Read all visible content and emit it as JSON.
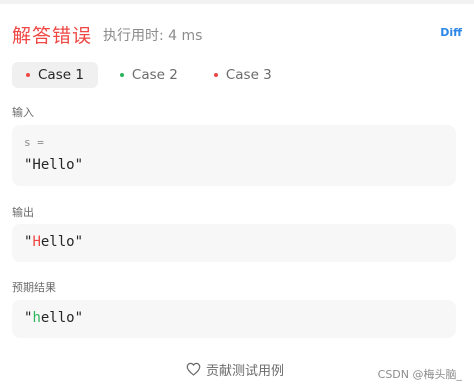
{
  "header": {
    "result": "解答错误",
    "runtime": "执行用时: 4 ms",
    "diff_label": "Diff"
  },
  "tabs": [
    {
      "label": "Case 1",
      "dot_color": "#ef4743",
      "active": true
    },
    {
      "label": "Case 2",
      "dot_color": "#2db55d",
      "active": false
    },
    {
      "label": "Case 3",
      "dot_color": "#ef4743",
      "active": false
    }
  ],
  "input": {
    "label": "输入",
    "var": "s =",
    "value": "\"Hello\""
  },
  "output": {
    "label": "输出",
    "prefix": "\"",
    "diff_char": "H",
    "rest": "ello\""
  },
  "expected": {
    "label": "预期结果",
    "prefix": "\"",
    "diff_char": "h",
    "rest": "ello\""
  },
  "footer": {
    "contribute": "贡献测试用例",
    "watermark": "CSDN @梅头脑_"
  },
  "colors": {
    "error": "#ef4743",
    "success": "#2db55d",
    "link": "#2c86e8"
  }
}
